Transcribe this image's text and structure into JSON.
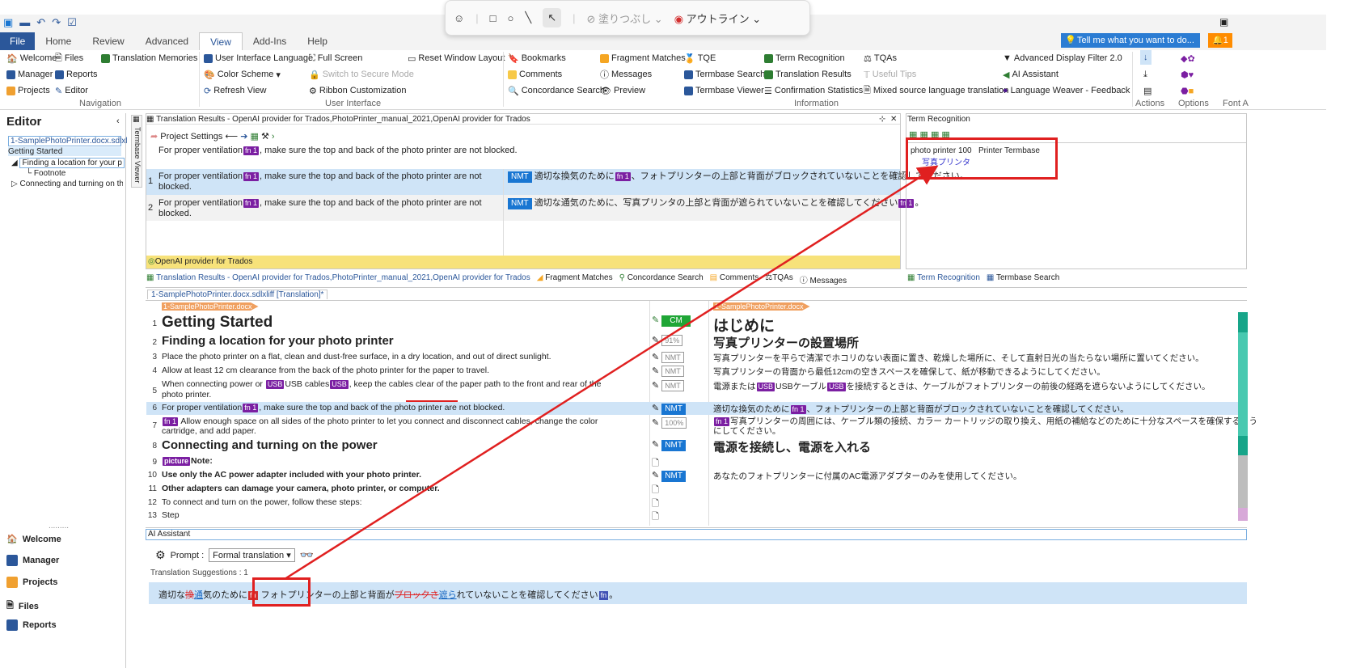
{
  "qat": {
    "icons": [
      "save-icon",
      "undo-icon",
      "redo-icon",
      "check-icon"
    ]
  },
  "ribbon_tabs": [
    "File",
    "Home",
    "Review",
    "Advanced",
    "View",
    "Add-Ins",
    "Help"
  ],
  "tell_me": "Tell me what you want to do...",
  "notification": "1",
  "floatbar": {
    "fill": "塗りつぶし",
    "outline": "アウトライン"
  },
  "ribbon": {
    "welcome": "Welcome",
    "files": "Files",
    "tm": "Translation Memories",
    "manager": "Manager",
    "reports": "Reports",
    "projects": "Projects",
    "editor": "Editor",
    "uil": "User Interface Language",
    "fullscreen": "Full Screen",
    "colorscheme": "Color Scheme",
    "secure": "Switch to Secure Mode",
    "refresh": "Refresh View",
    "ribboncust": "Ribbon Customization",
    "reset": "Reset Window Layout",
    "bookmarks": "Bookmarks",
    "fragment": "Fragment Matches",
    "tqe": "TQE",
    "termrec": "Term Recognition",
    "tqas": "TQAs",
    "comments": "Comments",
    "messages": "Messages",
    "termsearch": "Termbase Search",
    "transresults": "Translation Results",
    "usefultips": "Useful Tips",
    "concordance": "Concordance Search",
    "preview": "Preview",
    "termviewer": "Termbase Viewer",
    "confstats": "Confirmation Statistics",
    "mixed": "Mixed source language translation",
    "adf": "Advanced Display Filter 2.0",
    "aiassist": "AI Assistant",
    "lw": "Language Weaver - Feedback",
    "groups": {
      "nav": "Navigation",
      "ui": "User Interface",
      "info": "Information",
      "actions": "Actions",
      "options": "Options",
      "font": "Font A"
    }
  },
  "left": {
    "title": "Editor",
    "file": "1-SamplePhotoPrinter.docx.sdlxl",
    "items": [
      "Getting Started",
      "Finding a location for your p",
      "Footnote",
      "Connecting and turning on th"
    ],
    "nav": [
      "Welcome",
      "Manager",
      "Projects",
      "Files",
      "Reports"
    ],
    "dots": "........."
  },
  "tr": {
    "header": "Translation Results - OpenAI provider for Trados,PhotoPrinter_manual_2021,OpenAI provider for Trados",
    "project_settings": "Project Settings",
    "source": "For proper ventilation",
    "source_rest": ", make sure the top and back of the photo printer are not blocked.",
    "row1_src_a": "For proper ventilation",
    "row1_src_b": ", make sure the top and back of the photo printer are not",
    "row1_src_c": "blocked.",
    "row1_tgt_a": "適切な換気のために",
    "row1_tgt_b": "、フォトプリンターの上部と背面がブロックされていないことを確認してください。",
    "row2_tgt_a": "適切な通気のために、写真プリンタの上部と背面が遮られていないことを確認してください",
    "row2_tgt_b": "。",
    "nmt": "NMT",
    "fn": "fn 1",
    "provider": "OpenAI provider for Trados",
    "bottomtabs": {
      "tr": "Translation Results - OpenAI provider for Trados,PhotoPrinter_manual_2021,OpenAI provider for Trados",
      "fm": "Fragment Matches",
      "cs": "Concordance Search",
      "cm": "Comments",
      "tqa": "TQAs",
      "msg": "Messages"
    }
  },
  "term": {
    "header": "Term Recognition",
    "term": "photo printer",
    "score": "100",
    "termbase": "Printer Termbase",
    "translation": "写真プリンタ",
    "tabs": [
      "Term Recognition",
      "Termbase Search"
    ]
  },
  "editor": {
    "doctab": "1-SamplePhotoPrinter.docx.sdlxliff [Translation]*",
    "fileflag": "1-SamplePhotoPrinter.docx",
    "rows": [
      {
        "n": "1",
        "src": "Getting Started",
        "status": "CM",
        "tgt": "はじめに"
      },
      {
        "n": "2",
        "src": "Finding a location for your photo printer",
        "status": "91%",
        "tgt": "写真プリンターの設置場所"
      },
      {
        "n": "3",
        "src": "Place the photo printer on a flat, clean and dust-free surface, in a dry location, and out of direct sunlight.",
        "status": "NMT",
        "tgt": "写真プリンターを平らで清潔でホコリのない表面に置き、乾燥した場所に、そして直射日光の当たらない場所に置いてください。"
      },
      {
        "n": "4",
        "src": "Allow at least 12 cm clearance from the back of the photo printer for the paper to travel.",
        "status": "NMT",
        "tgt": "写真プリンターの背面から最低12cmの空きスペースを確保して、紙が移動できるようにしてください。"
      },
      {
        "n": "5",
        "src_a": "When connecting power or",
        "usb": "USB",
        "src_b": "USB cables",
        "src_c": ", keep the cables clear of the paper path to the front and rear of the",
        "src_d": "photo printer.",
        "status": "NMT",
        "tgt_a": "電源または",
        "tgt_b": "USBケーブル",
        "tgt_c": "を接続するときは、ケーブルがフォトプリンターの前後の経路を遮らないようにしてください。"
      },
      {
        "n": "6",
        "src_a": "For proper ventilation",
        "src_b": ", make sure the top and back of the photo printer are not blocked.",
        "status": "NMT",
        "tgt_a": "適切な換気のために",
        "tgt_b": "、フォトプリンターの上部と背面がブロックされていないことを確認してください。"
      },
      {
        "n": "7",
        "src_a": "Allow enough space on all sides of the photo printer to let you connect and disconnect cables, change the color",
        "src_b": "cartridge, and add paper.",
        "status": "100%",
        "tgt_a": "写真プリンターの周囲には、ケーブル類の接続、カラー カートリッジの取り換え、用紙の補給などのために十分なスペースを確保するよう",
        "tgt_b": "にしてください。"
      },
      {
        "n": "8",
        "src": "Connecting and turning on the power",
        "status": "NMT",
        "tgt": "電源を接続し、電源を入れる"
      },
      {
        "n": "9",
        "picture": "picture",
        "src": "Note:"
      },
      {
        "n": "10",
        "src": "Use only the AC power adapter included with your photo printer.",
        "status": "NMT",
        "tgt": "あなたのフォトプリンターに付属のAC電源アダプターのみを使用してください。"
      },
      {
        "n": "11",
        "src": "Other adapters can damage your camera, photo printer, or computer."
      },
      {
        "n": "12",
        "src": "To connect and turn on the power, follow these steps:"
      },
      {
        "n": "13",
        "src": "Step"
      }
    ]
  },
  "ai": {
    "header": "AI Assistant",
    "prompt_label": "Prompt :",
    "prompt_value": "Formal translation",
    "suggestions": "Translation Suggestions : 1",
    "sugg_a": "適切な",
    "sugg_del1": "換",
    "sugg_ins1": "通",
    "sugg_b": "気のために",
    "fn": "fn",
    "sugg_c": "フォトプリンターの上部と背面が",
    "sugg_del2": "ブロックさ",
    "sugg_ins2": "遮ら",
    "sugg_d": "れていないことを確認してください",
    "sugg_e": "。"
  },
  "colors": {
    "accent": "#2b579a",
    "nmt": "#1976d2",
    "cm": "#1fa636",
    "tag": "#7b1fa2",
    "annotation": "#e02020"
  }
}
